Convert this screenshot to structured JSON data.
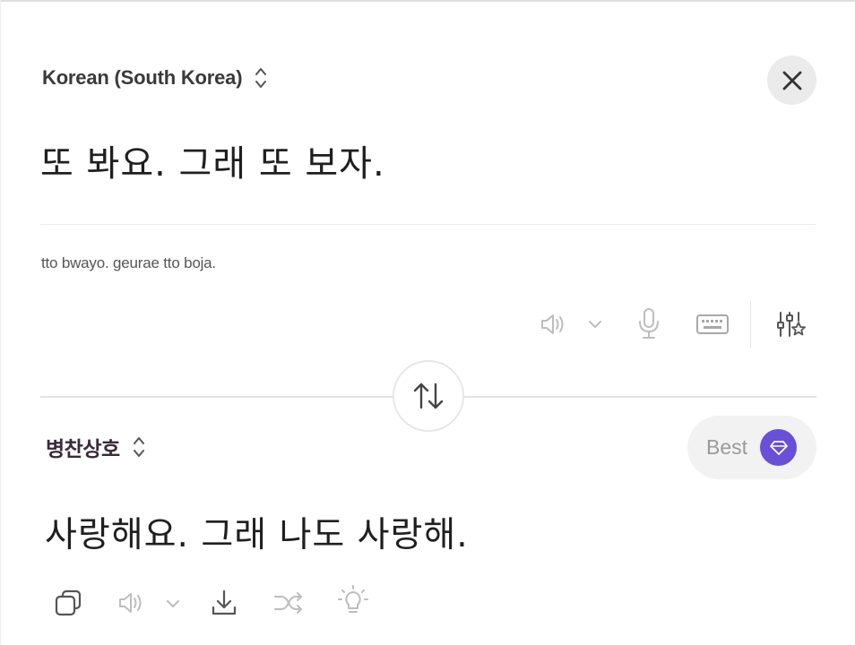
{
  "source": {
    "language_label": "Korean (South Korea)",
    "text": "또 봐요. 그래 또 보자.",
    "romanization": "tto bwayo. geurae tto boja."
  },
  "source_toolbar": {
    "icons": [
      "speaker-icon",
      "chevron-down-icon",
      "microphone-icon",
      "keyboard-icon",
      "sliders-star-icon"
    ]
  },
  "target": {
    "language_label": "병찬상호",
    "text": "사랑해요. 그래 나도 사랑해.",
    "best_label": "Best"
  },
  "target_toolbar": {
    "icons": [
      "copy-icon",
      "speaker-icon",
      "chevron-down-icon",
      "download-icon",
      "shuffle-icon",
      "lightbulb-icon"
    ]
  },
  "colors": {
    "accent": "#6a4fd9",
    "icon_gray": "#8f8f8f",
    "icon_light": "#bdbdbd",
    "border": "#e3e3e3"
  }
}
